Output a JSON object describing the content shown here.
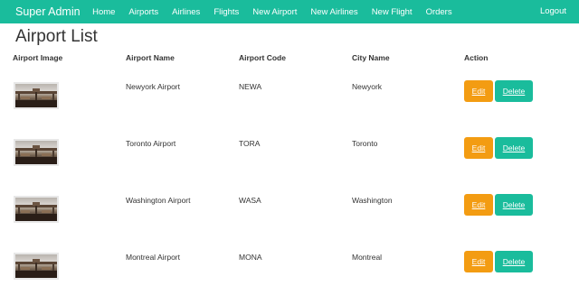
{
  "nav": {
    "brand": "Super Admin",
    "items": [
      "Home",
      "Airports",
      "Airlines",
      "Flights",
      "New Airport",
      "New Airlines",
      "New Flight",
      "Orders"
    ],
    "logout": "Logout"
  },
  "page": {
    "title": "Airport List"
  },
  "table": {
    "headers": [
      "Airport Image",
      "Airport Name",
      "Airport Code",
      "City Name",
      "Action"
    ],
    "rows": [
      {
        "name": "Newyork Airport",
        "code": "NEWA",
        "city": "Newyork",
        "edit": "Edit",
        "delete": "Delete"
      },
      {
        "name": "Toronto Airport",
        "code": "TORA",
        "city": "Toronto",
        "edit": "Edit",
        "delete": "Delete"
      },
      {
        "name": "Washington Airport",
        "code": "WASA",
        "city": "Washington",
        "edit": "Edit",
        "delete": "Delete"
      },
      {
        "name": "Montreal Airport",
        "code": "MONA",
        "city": "Montreal",
        "edit": "Edit",
        "delete": "Delete"
      }
    ]
  },
  "colors": {
    "primary": "#1abc9c",
    "warning": "#f39c12"
  },
  "icons": {
    "airport_image": "airport-terminal-photo"
  }
}
